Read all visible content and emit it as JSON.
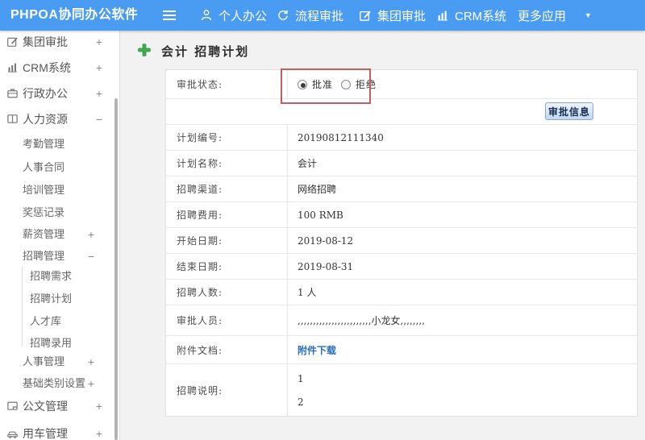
{
  "topbar": {
    "brand": "PHPOA协同办公软件",
    "nav": [
      {
        "label": "个人办公",
        "icon": "person-icon"
      },
      {
        "label": "流程审批",
        "icon": "process-icon"
      },
      {
        "label": "集团审批",
        "icon": "edit-icon"
      },
      {
        "label": "CRM系统",
        "icon": "bar-chart-icon"
      },
      {
        "label": "更多应用",
        "icon": "caret-down-icon"
      }
    ]
  },
  "sidebar": {
    "items": [
      {
        "label": "集团审批",
        "icon": "edit-icon",
        "expand": "+"
      },
      {
        "label": "CRM系统",
        "icon": "bar-chart-icon",
        "expand": "+"
      },
      {
        "label": "行政办公",
        "icon": "briefcase-icon",
        "expand": "+"
      },
      {
        "label": "人力资源",
        "icon": "book-icon",
        "expand": "−"
      },
      {
        "label": "考勤管理",
        "expand": ""
      },
      {
        "label": "人事合同",
        "expand": ""
      },
      {
        "label": "培训管理",
        "expand": ""
      },
      {
        "label": "奖惩记录",
        "expand": ""
      },
      {
        "label": "薪资管理",
        "expand": "+"
      },
      {
        "label": "招聘管理",
        "expand": "−"
      },
      {
        "label": "招聘需求",
        "expand": ""
      },
      {
        "label": "招聘计划",
        "expand": ""
      },
      {
        "label": "人才库",
        "expand": ""
      },
      {
        "label": "招聘录用",
        "expand": ""
      },
      {
        "label": "人事管理",
        "expand": "+"
      },
      {
        "label": "基础类别设置",
        "expand": "+"
      },
      {
        "label": "公文管理",
        "icon": "document-icon",
        "expand": "+"
      },
      {
        "label": "用车管理",
        "icon": "car-icon",
        "expand": "+"
      }
    ]
  },
  "main": {
    "title": "会计 招聘计划",
    "approval": {
      "label": "审批状态:",
      "options": [
        {
          "label": "批准",
          "selected": true
        },
        {
          "label": "拒绝",
          "selected": false
        }
      ],
      "button": "审批信息"
    },
    "fields": [
      {
        "label": "计划编号:",
        "value": "20190812111340"
      },
      {
        "label": "计划名称:",
        "value": "会计"
      },
      {
        "label": "招聘渠道:",
        "value": "网络招聘"
      },
      {
        "label": "招聘费用:",
        "value": "100 RMB"
      },
      {
        "label": "开始日期:",
        "value": "2019-08-12"
      },
      {
        "label": "结束日期:",
        "value": "2019-08-31"
      },
      {
        "label": "招聘人数:",
        "value": "1 人"
      },
      {
        "label": "审批人员:",
        "value": ",,,,,,,,,,,,,,,,,,,,,,,,小龙女,,,,,,,,"
      },
      {
        "label": "附件文档:",
        "value": "附件下载"
      },
      {
        "label": "招聘说明:",
        "value_lines": [
          "1",
          "2"
        ]
      }
    ]
  },
  "colors": {
    "topbar_blue": "#4a9bf2",
    "link_blue": "#2a6fb8",
    "highlight_red": "#c25f60",
    "plus_green": "#41ae4d"
  }
}
